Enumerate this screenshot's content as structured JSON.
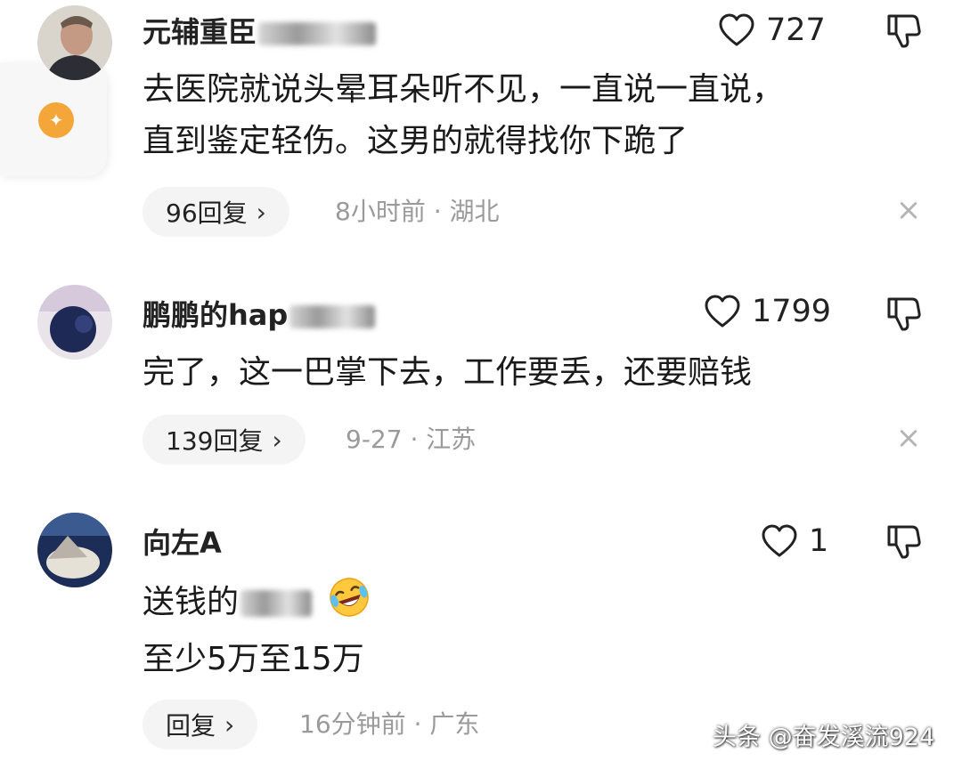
{
  "comments": [
    {
      "username": "元辅重臣",
      "likes": "727",
      "lines": [
        "去医院就说头晕耳朵听不见，一直说一直说，",
        "直到鉴定轻伤。这男的就得找你下跪了"
      ],
      "replies": "96回复",
      "time": "8小时前",
      "location": "湖北"
    },
    {
      "username": "鹏鹏的hap",
      "likes": "1799",
      "lines": [
        "完了，这一巴掌下去，工作要丢，还要赔钱"
      ],
      "replies": "139回复",
      "time": "9-27",
      "location": "江苏"
    },
    {
      "username": "向左A",
      "likes": "1",
      "lines": [
        "送钱的",
        "至少5万至15万"
      ],
      "replies": "回复",
      "time": "16分钟前",
      "location": "广东"
    }
  ],
  "ui": {
    "chevron": "›",
    "separator": "·",
    "close": "×"
  },
  "watermark": "头条 @奋发溪流924",
  "icons": [
    "heart-outline-icon",
    "thumbs-down-icon",
    "close-icon",
    "laughing-crying-emoji"
  ],
  "colors": {
    "text": "#1a1a1a",
    "meta": "#9a9a9a",
    "pill_bg": "#f4f4f4",
    "accent_orange": "#f4a638"
  }
}
